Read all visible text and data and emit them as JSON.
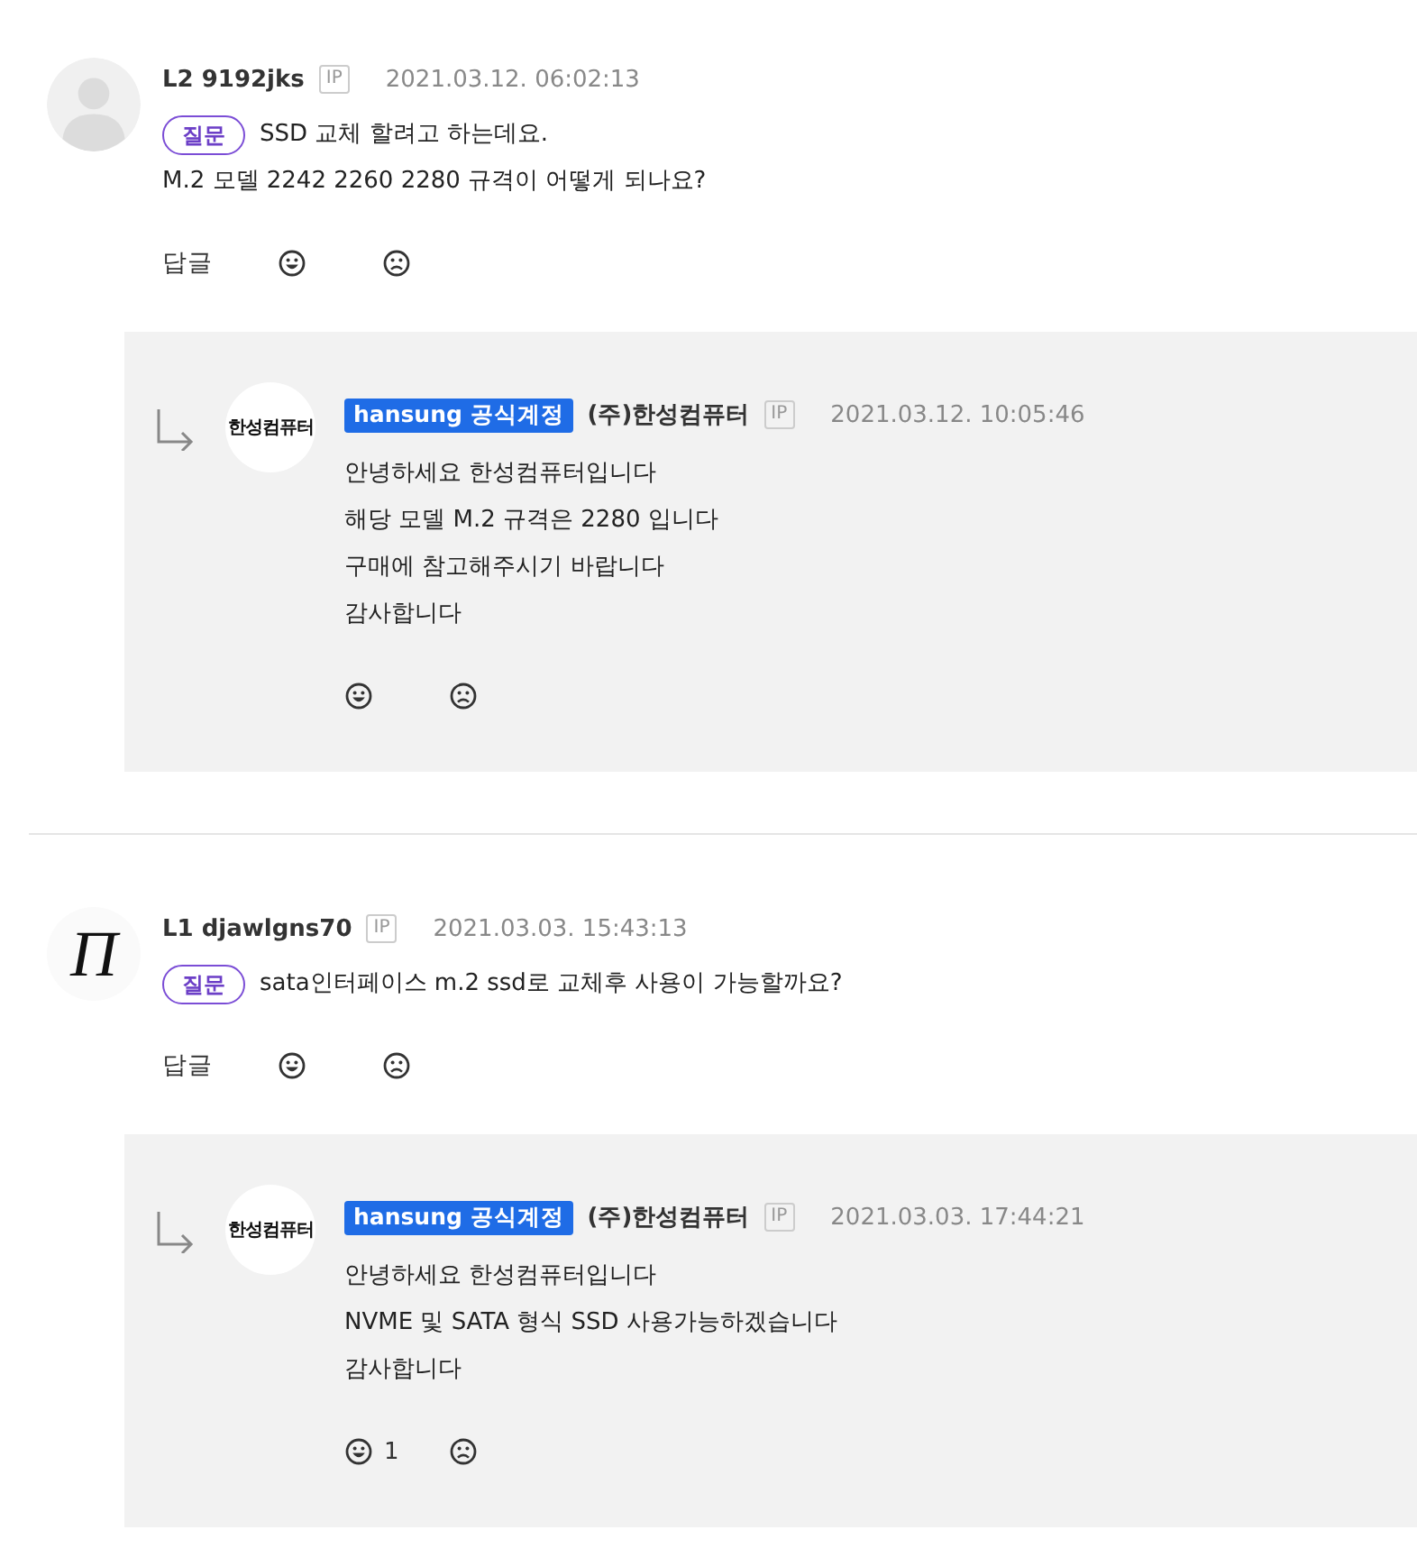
{
  "comments": [
    {
      "avatar": {
        "kind": "default"
      },
      "level_name": "L2 9192jks",
      "ip": "IP",
      "date": "2021.03.12. 06:02:13",
      "tag": "질문",
      "lines": [
        "SSD 교체 할려고 하는데요.",
        "M.2 모델 2242 2260 2280 규격이 어떻게 되나요?"
      ],
      "reply_label": "답글",
      "replies": [
        {
          "avatar": {
            "kind": "logo",
            "text": "한성컴퓨터"
          },
          "badge": "hansung 공식계정",
          "name": "(주)한성컴퓨터",
          "ip": "IP",
          "date": "2021.03.12. 10:05:46",
          "lines": [
            "안녕하세요 한성컴퓨터입니다",
            "해당 모델 M.2 규격은 2280 입니다",
            "구매에 참고해주시기 바랍니다",
            "감사합니다"
          ]
        }
      ]
    },
    {
      "avatar": {
        "kind": "letter",
        "text": "Π"
      },
      "level_name": "L1 djawlgns70",
      "ip": "IP",
      "date": "2021.03.03. 15:43:13",
      "tag": "질문",
      "lines": [
        "sata인터페이스 m.2 ssd로 교체후 사용이 가능할까요?"
      ],
      "reply_label": "답글",
      "replies": [
        {
          "avatar": {
            "kind": "logo",
            "text": "한성컴퓨터"
          },
          "badge": "hansung 공식계정",
          "name": "(주)한성컴퓨터",
          "ip": "IP",
          "date": "2021.03.03. 17:44:21",
          "lines": [
            "안녕하세요 한성컴퓨터입니다",
            "NVME 및 SATA 형식 SSD 사용가능하겠습니다",
            "감사합니다"
          ],
          "likes": "1"
        }
      ]
    }
  ]
}
